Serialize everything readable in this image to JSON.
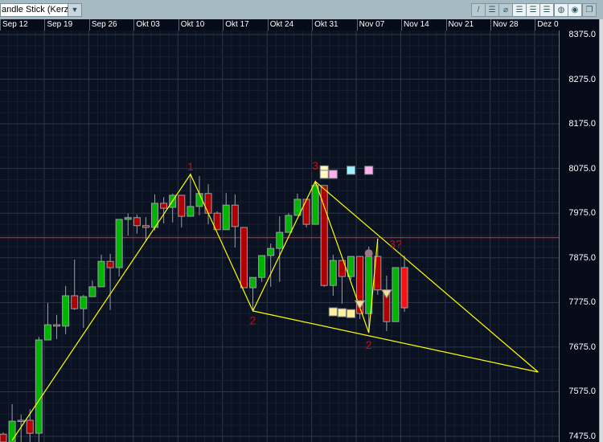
{
  "toolbar": {
    "chart_type_value": "andle Stick (Kerze",
    "buttons": [
      {
        "icon": "line-draw-icon",
        "glyph": "/"
      },
      {
        "icon": "horizontal-line-icon",
        "glyph": "☰"
      },
      {
        "icon": "delete-line-icon",
        "glyph": "⌀"
      },
      {
        "icon": "grid-1-icon",
        "glyph": "☰"
      },
      {
        "icon": "grid-2-icon",
        "glyph": "☰"
      },
      {
        "icon": "grid-3-icon",
        "glyph": "☰"
      },
      {
        "icon": "zoom-icon",
        "glyph": "◍"
      },
      {
        "icon": "pattern-icon",
        "glyph": "◉"
      },
      {
        "icon": "window-icon",
        "glyph": "❐"
      }
    ]
  },
  "chart_data": {
    "type": "candlestick",
    "x_tick_labels": [
      "Sep 12",
      "Sep 19",
      "Sep 26",
      "Okt 03",
      "Okt 10",
      "Okt 17",
      "Okt 24",
      "Okt 31",
      "Nov 07",
      "Nov 14",
      "Nov 21",
      "Nov 28",
      "Dez 0"
    ],
    "y_tick_labels": [
      "8375.0",
      "8275.0",
      "8175.0",
      "8075.0",
      "7975.0",
      "7875.0",
      "7775.0",
      "7675.0",
      "7575.0",
      "7475.0"
    ],
    "ylim": [
      7475,
      8375
    ],
    "grid": true,
    "colors": {
      "up": "#00b400",
      "down": "#b00000",
      "last_down": "#ff1010",
      "wick": "#9aa0a8",
      "drawing": "#ffff00",
      "hline": "#e03030",
      "label": "#c0101a",
      "background": "#0a1120"
    },
    "candles": [
      {
        "date": "09-12",
        "o": 7480,
        "h": 7484,
        "l": 7462,
        "c": 7462
      },
      {
        "date": "09-13",
        "o": 7462,
        "h": 7547,
        "l": 7462,
        "c": 7509
      },
      {
        "date": "09-14",
        "o": 7511,
        "h": 7524,
        "l": 7462,
        "c": 7510
      },
      {
        "date": "09-15",
        "o": 7511,
        "h": 7536,
        "l": 7462,
        "c": 7482
      },
      {
        "date": "09-16",
        "o": 7482,
        "h": 7698,
        "l": 7462,
        "c": 7691
      },
      {
        "date": "09-19",
        "o": 7691,
        "h": 7774,
        "l": 7691,
        "c": 7725
      },
      {
        "date": "09-20",
        "o": 7725,
        "h": 7747,
        "l": 7693,
        "c": 7722
      },
      {
        "date": "09-21",
        "o": 7722,
        "h": 7812,
        "l": 7704,
        "c": 7790
      },
      {
        "date": "09-22",
        "o": 7790,
        "h": 7871,
        "l": 7758,
        "c": 7761
      },
      {
        "date": "09-23",
        "o": 7761,
        "h": 7792,
        "l": 7718,
        "c": 7788
      },
      {
        "date": "09-26",
        "o": 7788,
        "h": 7824,
        "l": 7788,
        "c": 7810
      },
      {
        "date": "09-27",
        "o": 7810,
        "h": 7882,
        "l": 7810,
        "c": 7867
      },
      {
        "date": "09-28",
        "o": 7867,
        "h": 7884,
        "l": 7758,
        "c": 7853
      },
      {
        "date": "09-29",
        "o": 7853,
        "h": 7961,
        "l": 7833,
        "c": 7961
      },
      {
        "date": "09-30",
        "o": 7961,
        "h": 7974,
        "l": 7925,
        "c": 7965
      },
      {
        "date": "10-03",
        "o": 7965,
        "h": 7972,
        "l": 7929,
        "c": 7947
      },
      {
        "date": "10-04",
        "o": 7947,
        "h": 7966,
        "l": 7912,
        "c": 7943
      },
      {
        "date": "10-05",
        "o": 7943,
        "h": 8017,
        "l": 7936,
        "c": 7997
      },
      {
        "date": "10-06",
        "o": 7997,
        "h": 8011,
        "l": 7952,
        "c": 7986
      },
      {
        "date": "10-07",
        "o": 7988,
        "h": 8019,
        "l": 7954,
        "c": 8015
      },
      {
        "date": "10-10",
        "o": 8015,
        "h": 8015,
        "l": 7943,
        "c": 7968
      },
      {
        "date": "10-11",
        "o": 7968,
        "h": 8064,
        "l": 7968,
        "c": 7990
      },
      {
        "date": "10-12",
        "o": 7990,
        "h": 8058,
        "l": 7970,
        "c": 8019
      },
      {
        "date": "10-13",
        "o": 8019,
        "h": 8040,
        "l": 7950,
        "c": 7975
      },
      {
        "date": "10-14",
        "o": 7975,
        "h": 7979,
        "l": 7938,
        "c": 7938
      },
      {
        "date": "10-17",
        "o": 7938,
        "h": 8020,
        "l": 7938,
        "c": 7993
      },
      {
        "date": "10-18",
        "o": 7993,
        "h": 8017,
        "l": 7898,
        "c": 7945
      },
      {
        "date": "10-19",
        "o": 7943,
        "h": 7943,
        "l": 7808,
        "c": 7808
      },
      {
        "date": "10-20",
        "o": 7808,
        "h": 7831,
        "l": 7756,
        "c": 7831
      },
      {
        "date": "10-21",
        "o": 7831,
        "h": 7880,
        "l": 7821,
        "c": 7880
      },
      {
        "date": "10-24",
        "o": 7880,
        "h": 7907,
        "l": 7810,
        "c": 7896
      },
      {
        "date": "10-25",
        "o": 7896,
        "h": 7968,
        "l": 7821,
        "c": 7932
      },
      {
        "date": "10-26",
        "o": 7932,
        "h": 7975,
        "l": 7932,
        "c": 7970
      },
      {
        "date": "10-27",
        "o": 7970,
        "h": 8019,
        "l": 7970,
        "c": 8006
      },
      {
        "date": "10-28",
        "o": 8006,
        "h": 8006,
        "l": 7943,
        "c": 7950
      },
      {
        "date": "10-31",
        "o": 7950,
        "h": 8047,
        "l": 7950,
        "c": 8037
      },
      {
        "date": "11-01",
        "o": 8037,
        "h": 8037,
        "l": 7810,
        "c": 7813
      },
      {
        "date": "11-02",
        "o": 7813,
        "h": 7882,
        "l": 7790,
        "c": 7869
      },
      {
        "date": "11-03",
        "o": 7869,
        "h": 7869,
        "l": 7772,
        "c": 7833
      },
      {
        "date": "11-04",
        "o": 7833,
        "h": 7878,
        "l": 7826,
        "c": 7878
      },
      {
        "date": "11-07",
        "o": 7878,
        "h": 7878,
        "l": 7738,
        "c": 7750
      },
      {
        "date": "11-08",
        "o": 7750,
        "h": 7900,
        "l": 7709,
        "c": 7878
      },
      {
        "date": "11-09",
        "o": 7878,
        "h": 7918,
        "l": 7792,
        "c": 7803
      },
      {
        "date": "11-10",
        "o": 7803,
        "h": 7835,
        "l": 7711,
        "c": 7732
      },
      {
        "date": "11-11",
        "o": 7732,
        "h": 7853,
        "l": 7732,
        "c": 7853
      },
      {
        "date": "11-14",
        "o": 7853,
        "h": 7880,
        "l": 7754,
        "c": 7763
      }
    ],
    "horizontal_line": 7920,
    "trendlines": [
      {
        "points": [
          [
            "09-13",
            7466
          ],
          [
            "10-11",
            8062
          ],
          [
            "10-20",
            7756
          ],
          [
            "10-31",
            8046
          ],
          [
            "11-08",
            7707
          ],
          [
            "11-09",
            7918
          ]
        ]
      },
      {
        "points": [
          [
            "10-31",
            8046
          ],
          [
            "12-05",
            7619
          ]
        ]
      },
      {
        "points": [
          [
            "10-20",
            7756
          ],
          [
            "12-05",
            7619
          ]
        ]
      }
    ],
    "wave_labels": [
      {
        "text": "1",
        "date": "10-11",
        "price": 8080
      },
      {
        "text": "2",
        "date": "10-20",
        "price": 7735
      },
      {
        "text": "3",
        "date": "10-31",
        "price": 8082
      },
      {
        "text": "2",
        "date": "11-08",
        "price": 7680
      },
      {
        "text": "3?",
        "date": "11-11",
        "price": 7906
      }
    ],
    "markers": [
      {
        "shape": "square",
        "color": "#fff8c0",
        "date": "11-01",
        "price": 8072
      },
      {
        "shape": "square",
        "color": "#fff8c0",
        "date": "11-01",
        "price": 8062
      },
      {
        "shape": "square",
        "color": "#ffb0f0",
        "date": "11-02",
        "price": 8062
      },
      {
        "shape": "square",
        "color": "#a0f0ff",
        "date": "11-04",
        "price": 8071
      },
      {
        "shape": "square",
        "color": "#ffb0f0",
        "date": "11-08",
        "price": 8071
      },
      {
        "shape": "square",
        "color": "#fff0a0",
        "date": "11-02",
        "price": 7754
      },
      {
        "shape": "square",
        "color": "#fff0a0",
        "date": "11-03",
        "price": 7752
      },
      {
        "shape": "square",
        "color": "#fff0a0",
        "date": "11-04",
        "price": 7750
      },
      {
        "shape": "triangle-down",
        "color": "#f0e090",
        "date": "11-07",
        "price": 7770
      },
      {
        "shape": "triangle-down",
        "color": "#f0e090",
        "date": "11-10",
        "price": 7794
      },
      {
        "shape": "circle",
        "color": "#9a7a80",
        "date": "11-08",
        "price": 7885
      }
    ]
  }
}
